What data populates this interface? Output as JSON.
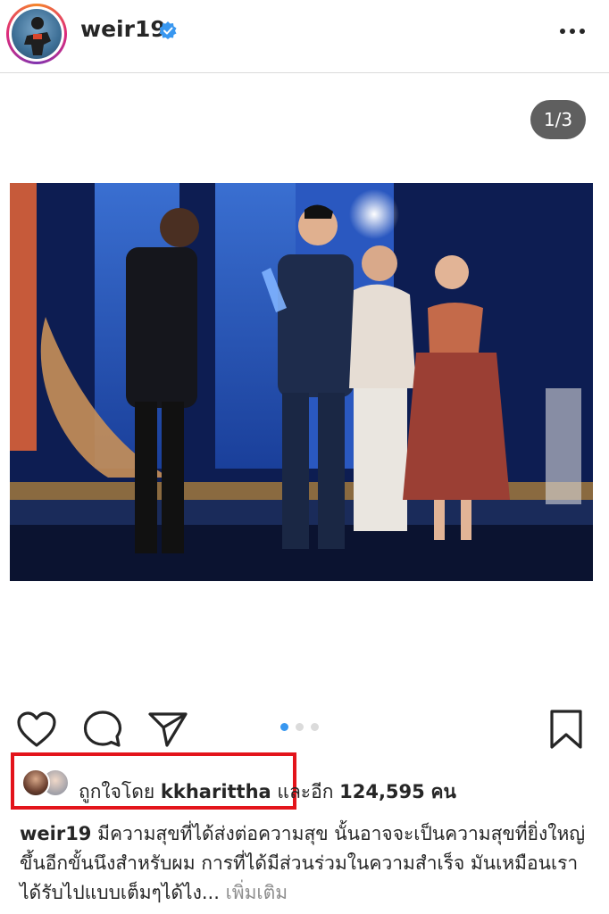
{
  "header": {
    "username": "weir19",
    "verified": true,
    "more_icon": "more-horizontal-icon"
  },
  "post": {
    "page_indicator": "1/3",
    "photo_description": "stage-award-photo",
    "carousel": {
      "total": 3,
      "active": 1
    }
  },
  "actions": {
    "like_icon": "heart-icon",
    "comment_icon": "comment-icon",
    "share_icon": "send-icon",
    "save_icon": "bookmark-icon"
  },
  "likes": {
    "prefix": "ถูกใจโดย",
    "user": "kkharittha",
    "middle": "และอีก",
    "count": "124,595",
    "suffix": "คน"
  },
  "caption": {
    "user": "weir19",
    "text": "มีความสุขที่ได้ส่งต่อความสุข นั้นอาจจะเป็นความสุขที่ยิ่งใหญ่ขึ้นอีกขั้นนึงสำหรับผม การที่ได้มีส่วนร่วมในความสำเร็จ มันเหมือนเราได้รับไปแบบเต็มๆได้ไง...",
    "more_label": "เพิ่มเติม"
  },
  "colors": {
    "highlight_box": "#e3141b",
    "verified_blue": "#3897f0",
    "dot_active": "#3897f0",
    "dot_inactive": "#dbdbdb"
  }
}
